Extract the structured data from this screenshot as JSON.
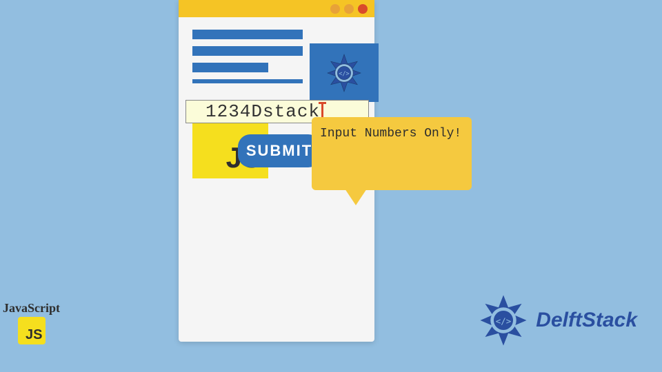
{
  "tooltip": {
    "message": "Input Numbers Only!"
  },
  "input": {
    "value": "1234Dstack"
  },
  "submit": {
    "label": "SUBMIT"
  },
  "js_block": {
    "label": "JS"
  },
  "badge": {
    "label": "JavaScript",
    "abbr": "JS"
  },
  "brand": {
    "name": "DelftStack"
  },
  "colors": {
    "bg": "#92bee0",
    "blue": "#3273ba",
    "yellow": "#f5c425",
    "js_yellow": "#f5df1e",
    "tooltip": "#f5c93f",
    "red": "#d94a2b"
  }
}
